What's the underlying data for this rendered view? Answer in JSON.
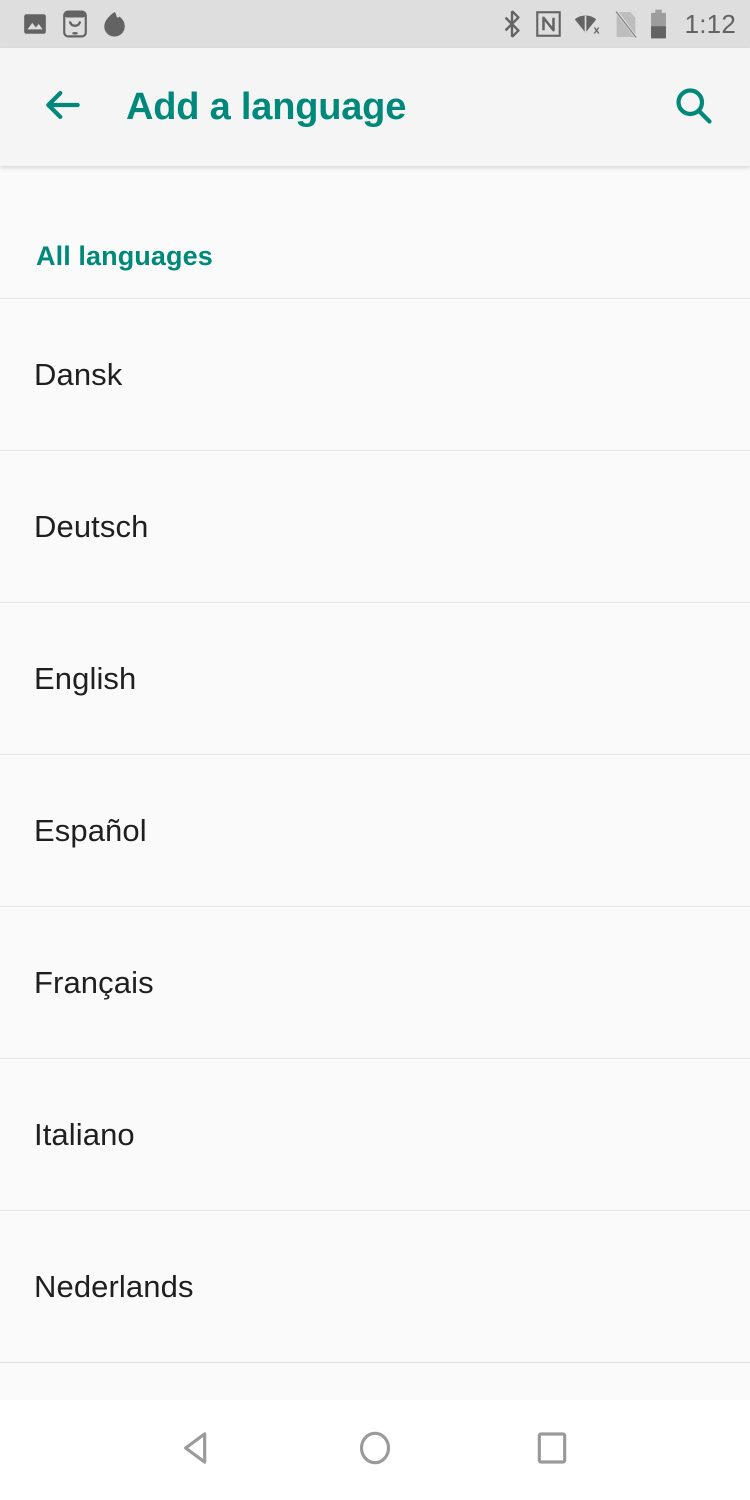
{
  "status_bar": {
    "background": "#dedede",
    "icon_color": "#636363",
    "clock": "1:12",
    "left_icons": [
      {
        "name": "photo-image-icon",
        "label": "Screenshot / image notification"
      },
      {
        "name": "smiley-app-icon",
        "label": "Messaging app notification"
      },
      {
        "name": "flame-blob-icon",
        "label": "App notification"
      }
    ],
    "right_icons": [
      {
        "name": "bluetooth-icon",
        "label": "Bluetooth on"
      },
      {
        "name": "nfc-icon",
        "label": "NFC on"
      },
      {
        "name": "wifi-no-internet-icon",
        "label": "Wi-Fi no internet"
      },
      {
        "name": "no-sim-icon",
        "label": "No SIM card"
      },
      {
        "name": "battery-icon",
        "label": "Battery",
        "level_percent": 40
      }
    ]
  },
  "toolbar": {
    "background": "#f5f5f5",
    "accent_color": "#00897b",
    "title": "Add a language",
    "back_icon": "arrow-back-icon",
    "search_icon": "search-icon"
  },
  "content": {
    "background": "#fafafa",
    "section_header": {
      "label": "All languages",
      "color": "#00897b"
    },
    "divider_color": "#e4e4e4",
    "text_color": "#1f1f1f",
    "languages": [
      {
        "label": "Dansk"
      },
      {
        "label": "Deutsch"
      },
      {
        "label": "English"
      },
      {
        "label": "Español"
      },
      {
        "label": "Français"
      },
      {
        "label": "Italiano"
      },
      {
        "label": "Nederlands"
      }
    ]
  },
  "nav_bar": {
    "background": "#ffffff",
    "icon_color": "#9a9a9a",
    "buttons": [
      {
        "name": "nav-back-button",
        "icon": "triangle-back-icon",
        "label": "Back"
      },
      {
        "name": "nav-home-button",
        "icon": "circle-home-icon",
        "label": "Home"
      },
      {
        "name": "nav-recents-button",
        "icon": "square-recents-icon",
        "label": "Recents"
      }
    ]
  }
}
